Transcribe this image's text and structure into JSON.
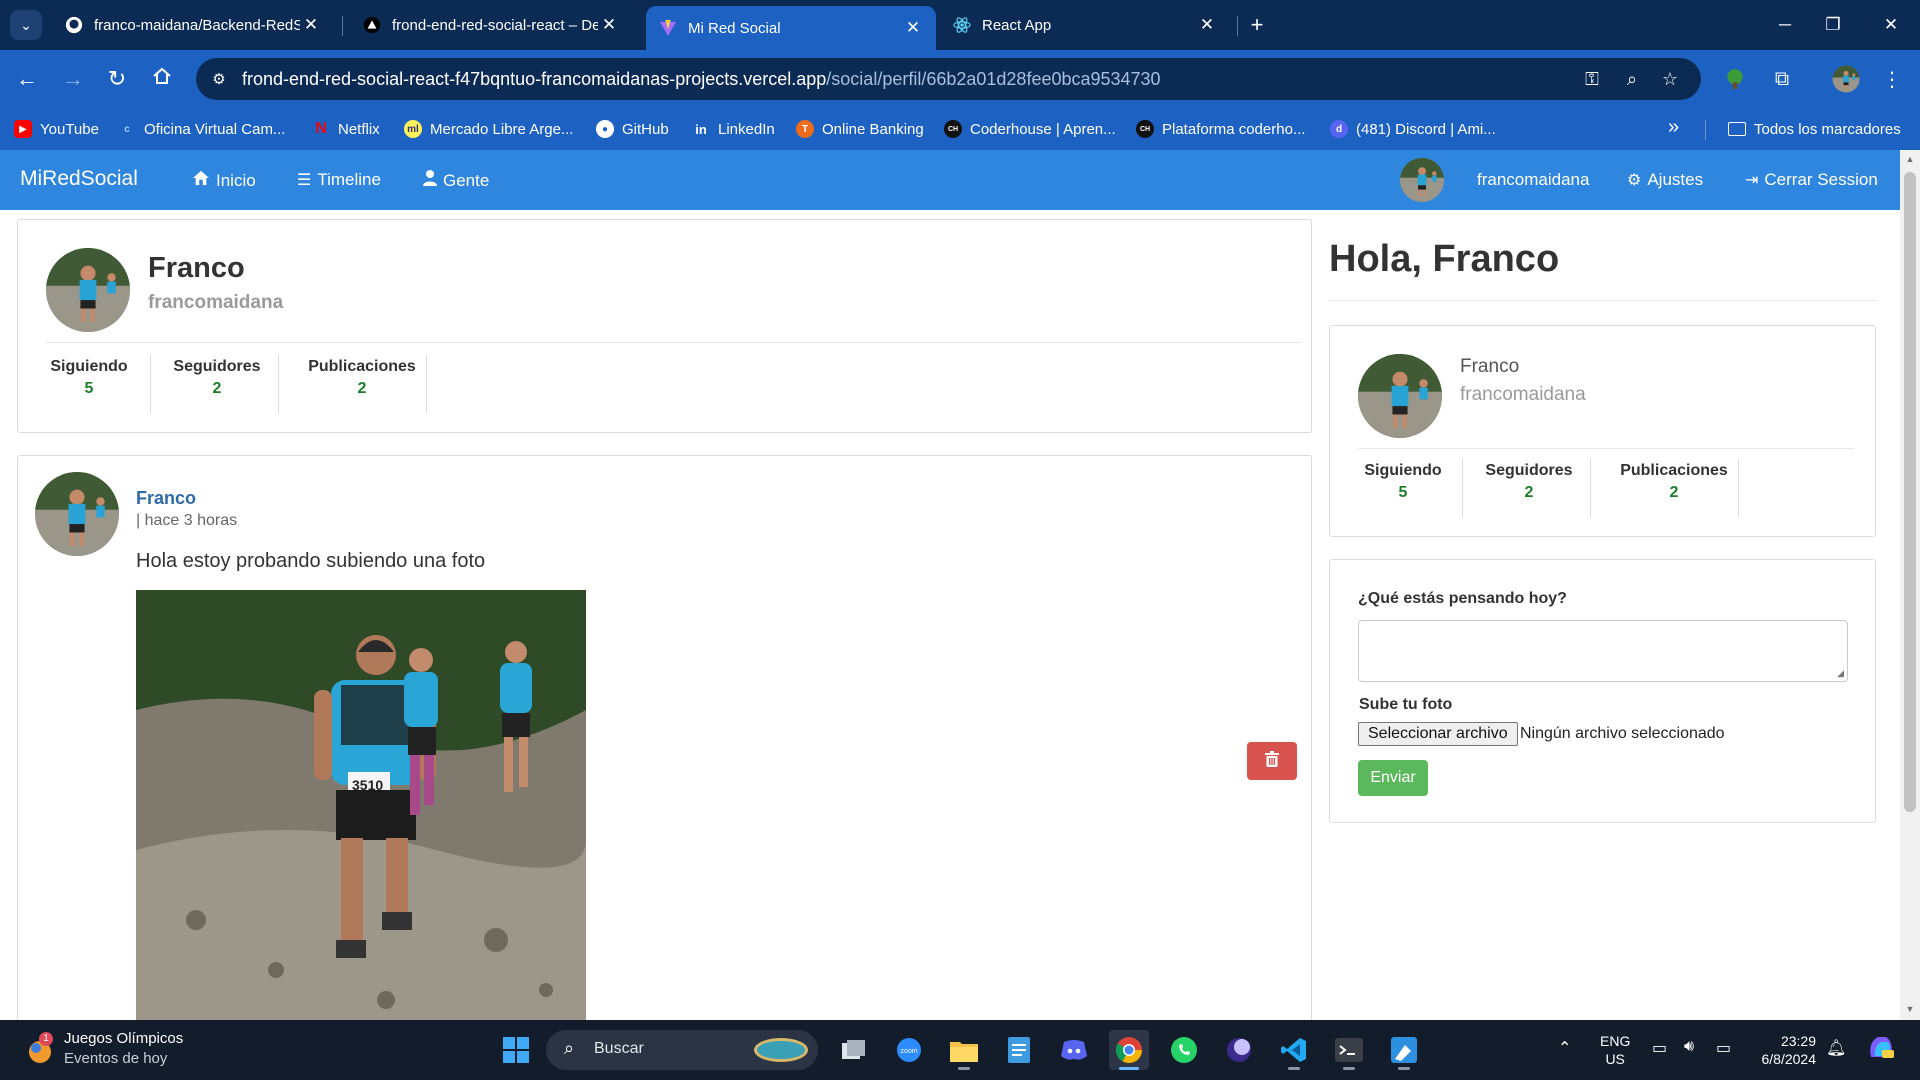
{
  "browser": {
    "tabs": [
      {
        "title": "franco-maidana/Backend-RedS",
        "favicon": "github-icon",
        "active": false
      },
      {
        "title": "frond-end-red-social-react – De",
        "favicon": "vercel-icon",
        "active": false
      },
      {
        "title": "Mi Red Social",
        "favicon": "vite-icon",
        "active": true
      },
      {
        "title": "React App",
        "favicon": "react-icon",
        "active": false
      }
    ],
    "url": {
      "host": "frond-end-red-social-react-f47bqntuo-francomaidanas-projects.vercel.app",
      "path": "/social/perfil/66b2a01d28fee0bca9534730"
    },
    "bookmarks": [
      {
        "label": "YouTube",
        "icon": "youtube-icon",
        "color": "#ff0000"
      },
      {
        "label": "Oficina Virtual Cam...",
        "icon": "oficina-icon",
        "color": "#1d61c2"
      },
      {
        "label": "Netflix",
        "icon": "netflix-icon",
        "color": "#e50914"
      },
      {
        "label": "Mercado Libre Arge...",
        "icon": "mercadolibre-icon",
        "color": "#fff159"
      },
      {
        "label": "GitHub",
        "icon": "github-icon",
        "color": "#ffffff"
      },
      {
        "label": "LinkedIn",
        "icon": "linkedin-icon",
        "color": "#1d61c2"
      },
      {
        "label": "Online Banking",
        "icon": "banking-icon",
        "color": "#ec6b1c"
      },
      {
        "label": "Coderhouse | Apren...",
        "icon": "coderhouse-icon",
        "color": "#111111"
      },
      {
        "label": "Plataforma coderho...",
        "icon": "coderhouse-icon",
        "color": "#111111"
      },
      {
        "label": "(481) Discord | Ami...",
        "icon": "discord-icon",
        "color": "#5865f2"
      }
    ],
    "all_bookmarks_label": "Todos los marcadores"
  },
  "app": {
    "brand": "MiRedSocial",
    "nav": {
      "inicio": "Inicio",
      "timeline": "Timeline",
      "gente": "Gente",
      "username": "francomaidana",
      "ajustes": "Ajustes",
      "logout": "Cerrar Session"
    },
    "profile": {
      "name": "Franco",
      "nick": "francomaidana",
      "stats": [
        {
          "label": "Siguiendo",
          "value": "5"
        },
        {
          "label": "Seguidores",
          "value": "2"
        },
        {
          "label": "Publicaciones",
          "value": "2"
        }
      ]
    },
    "post": {
      "author": "Franco",
      "time": "| hace 3 horas",
      "text": "Hola estoy probando subiendo una foto",
      "bib_number": "3510"
    },
    "sidebar": {
      "greeting": "Hola, Franco",
      "name": "Franco",
      "nick": "francomaidana",
      "stats": [
        {
          "label": "Siguiendo",
          "value": "5"
        },
        {
          "label": "Seguidores",
          "value": "2"
        },
        {
          "label": "Publicaciones",
          "value": "2"
        }
      ],
      "form": {
        "question_label": "¿Qué estás pensando hoy?",
        "textarea_value": "",
        "photo_label": "Sube tu foto",
        "file_button": "Seleccionar archivo",
        "file_status": "Ningún archivo seleccionado",
        "submit": "Enviar"
      }
    },
    "colors": {
      "navbar": "#2e86de",
      "follow_count": "#1e7d2b",
      "delete": "#d9534f",
      "submit": "#5cb85c",
      "author_link": "#2f6aa8"
    }
  },
  "taskbar": {
    "news_title": "Juegos Olímpicos",
    "news_subtitle": "Eventos de hoy",
    "news_badge": "1",
    "search_placeholder": "Buscar",
    "apps": [
      "task-view-icon",
      "zoom-icon",
      "file-explorer-icon",
      "notepad-icon",
      "discord-icon",
      "chrome-icon",
      "whatsapp-icon",
      "app-icon",
      "vscode-icon",
      "terminal-icon",
      "paint-icon"
    ],
    "language": {
      "line1": "ENG",
      "line2": "US"
    },
    "time": "23:29",
    "date": "6/8/2024"
  }
}
